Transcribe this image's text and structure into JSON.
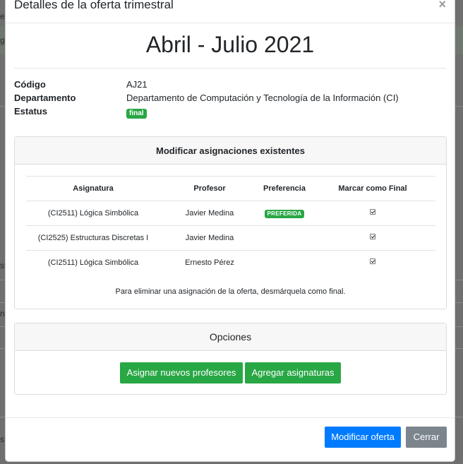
{
  "modal": {
    "title": "Detalles de la oferta trimestral",
    "close_glyph": "×",
    "heading": "Abril - Julio 2021"
  },
  "info": {
    "codigo_label": "Código",
    "codigo_value": "AJ21",
    "departamento_label": "Departamento",
    "departamento_value": "Departamento de Computación y Tecnología de la Información (CI)",
    "estatus_label": "Estatus",
    "estatus_value": "final"
  },
  "assignments": {
    "header": "Modificar asignaciones existentes",
    "columns": [
      "Asignatura",
      "Profesor",
      "Preferencia",
      "Marcar como Final"
    ],
    "rows": [
      {
        "asignatura": "(CI2511) Lógica Simbólica",
        "profesor": "Javier Medina",
        "preferencia": "PREFERIDA",
        "final": true
      },
      {
        "asignatura": "(CI2525) Estructuras Discretas I",
        "profesor": "Javier Medina",
        "preferencia": "",
        "final": true
      },
      {
        "asignatura": "(CI2511) Lógica Simbólica",
        "profesor": "Ernesto Pérez",
        "preferencia": "",
        "final": true
      }
    ],
    "note": "Para eliminar una asignación de la oferta, desmárquela como final."
  },
  "options": {
    "header": "Opciones",
    "assign_new_label": "Asignar nuevos profesores",
    "add_subjects_label": "Agregar asignaturas"
  },
  "footer": {
    "modify_label": "Modificar oferta",
    "close_label": "Cerrar"
  },
  "background": {
    "fragments": [
      "g",
      "es",
      "st",
      "ni",
      "st"
    ]
  },
  "colors": {
    "success": "#28a745",
    "primary": "#007bff",
    "secondary": "#7c858c"
  }
}
